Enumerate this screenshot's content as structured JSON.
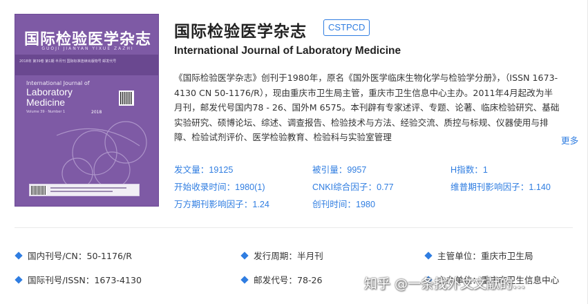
{
  "journal": {
    "title_cn": "国际检验医学杂志",
    "badge": "CSTPCD",
    "title_en": "International Journal of Laboratory Medicine",
    "description": "《国际检验医学杂志》创刊于1980年，原名《国外医学临床生物化学与检验学分册》，（ISSN 1673-4130 CN 50-1176/R），现由重庆市卫生局主管，重庆市卫生信息中心主办。2011年4月起改为半月刊，邮发代号国内78 - 26、国外M 6575。本刊辟有专家述评、专题、论著、临床检验研究、基础实验研究、硕博论坛、综述、调查报告、检验技术与方法、经验交流、质控与标规、仪器使用与排障、检验试剂评价、医学检验教育、检验科与实验室管理",
    "more_label": "更多"
  },
  "cover": {
    "title": "国际检验医学杂志",
    "pinyin": "GUOJI JIANYAN YIXUE ZAZHI",
    "strip_text": "2018年 第39卷 第1期  半月刊 国际标准连续出版物号 邮发代号",
    "en_line1": "International Journal of",
    "en_line2": "Laboratory",
    "en_line3": "Medicine",
    "volume": "Volume 39 · Number 1",
    "year": "2018",
    "accent_color": "#7e5aa5"
  },
  "stats": [
    {
      "label": "发文量：",
      "value": "19125"
    },
    {
      "label": "被引量：",
      "value": "9957"
    },
    {
      "label": "H指数：",
      "value": "1"
    },
    {
      "label": "开始收录时间：",
      "value": "1980(1)"
    },
    {
      "label": "CNKI综合因子：",
      "value": "0.77"
    },
    {
      "label": "维普期刊影响因子：",
      "value": "1.140"
    },
    {
      "label": "万方期刊影响因子：",
      "value": "1.24"
    },
    {
      "label": "创刊时间：",
      "value": "1980"
    }
  ],
  "info": [
    {
      "label": "国内刊号/CN：",
      "value": "50-1176/R"
    },
    {
      "label": "发行周期：",
      "value": "半月刊"
    },
    {
      "label": "主管单位：",
      "value": "重庆市卫生局"
    },
    {
      "label": "国际刊号/ISSN：",
      "value": "1673-4130"
    },
    {
      "label": "邮发代号：",
      "value": "78-26"
    },
    {
      "label": "主办单位：",
      "value": "重庆市卫生信息中心"
    }
  ],
  "watermark": "知乎 @一条找外文文献的..."
}
